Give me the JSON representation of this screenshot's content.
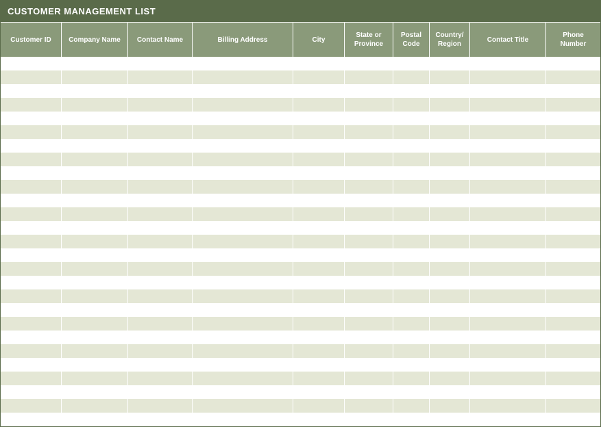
{
  "title": "CUSTOMER MANAGEMENT LIST",
  "columns": [
    "Customer ID",
    "Company Name",
    "Contact Name",
    "Billing Address",
    "City",
    "State or Province",
    "Postal Code",
    "Country/ Region",
    "Contact Title",
    "Phone Number"
  ],
  "rowCount": 27,
  "rows": []
}
